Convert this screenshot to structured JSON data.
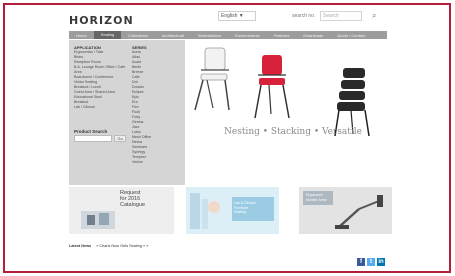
{
  "header": {
    "logo": "HORIZON",
    "language_select": "English ▼",
    "search_label": "search no.",
    "search_placeholder": "Search"
  },
  "nav": {
    "items": [
      "Home",
      "Seating",
      "Collections",
      "Architectural",
      "Workstations",
      "Environments",
      "Features",
      "Downloads",
      "Quote / Contact"
    ]
  },
  "menu": {
    "col1_heading": "APPLICATION",
    "col1_items": [
      "Ergonomics / Task",
      "Bistro",
      "Reception Room",
      "B.A. Lounge Room Office / Cafe Area",
      "Boardroom / Conference",
      "Visitor Seating",
      "Breakout / Lunch",
      "Guest Area / Shared Area",
      "Educational Stool",
      "Breakout",
      "Lab / Clinical"
    ],
    "col2_heading": "SERIES",
    "col2_items": [
      "Aorta",
      "Atlas",
      "Avant",
      "Berlin",
      "Breeze",
      "Cafe",
      "Dot",
      "Dorado",
      "Eclipse",
      "Epic",
      "Era",
      "Flex",
      "Fluid",
      "Forty",
      "Genius",
      "Jazz",
      "Lotus",
      "Mesh Office",
      "Nexus",
      "Seminars",
      "Synergy",
      "Tempest",
      "Venice"
    ],
    "product_search_label": "Product Search",
    "product_search_go": "Go"
  },
  "hero": {
    "tagline": "Nesting • Stacking • Versatile"
  },
  "promos": {
    "p1_text": [
      "Request",
      "for 2016",
      "Catalogue"
    ],
    "p2_text": [
      "Lab & Clinical",
      "Furniture",
      "Seating"
    ],
    "p3_text": [
      "Ergonomic",
      "Monitor Arms"
    ]
  },
  "latest": {
    "label": "Latest News",
    "text": "» Charis Now Gets Seating » »"
  },
  "social": {
    "facebook": "f",
    "twitter": "t",
    "linkedin": "in"
  },
  "colors": {
    "frame": "#b21e3c",
    "nav_bg": "#9c9c9c",
    "menu_bg": "#d5d5d5",
    "red_chair": "#d8213a",
    "facebook": "#3b5998",
    "twitter": "#55acee",
    "linkedin": "#0077b5"
  }
}
